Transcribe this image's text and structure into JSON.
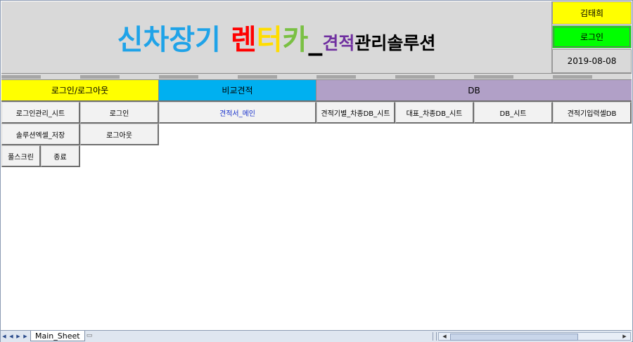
{
  "header": {
    "title_parts": [
      {
        "text": "신",
        "color": "#1fa3e8"
      },
      {
        "text": "차",
        "color": "#1fa3e8"
      },
      {
        "text": "장",
        "color": "#1fa3e8"
      },
      {
        "text": "기",
        "color": "#1fa3e8"
      },
      {
        "text": "렌",
        "color": "#ff0000"
      },
      {
        "text": "터",
        "color": "#ffdd00"
      },
      {
        "text": "카",
        "color": "#7ac043"
      },
      {
        "text": "_",
        "color": "#000000"
      },
      {
        "text": "견적",
        "color": "#7030a0"
      },
      {
        "text": "관리솔루션",
        "color": "#000000"
      }
    ],
    "user_name": "김태희",
    "login_button": "로그인",
    "date": "2019-08-08"
  },
  "sections": {
    "login": "로그인/로그아웃",
    "compare": "비교견적",
    "db": "DB"
  },
  "buttons": {
    "login_admin_sheet": "로그인관리_시트",
    "login": "로그인",
    "solution_excel_save": "솔루션엑셀_저장",
    "logout": "로그아웃",
    "fullscreen": "풀스크린",
    "exit": "종료",
    "estimate_main": "견적서_메인",
    "estimate_model_db_sheet": "견적기별_차종DB_시트",
    "representative_model_db_sheet": "대표_차종DB_시트",
    "db_sheet": "DB_시트",
    "estimate_input_cell_db": "견적기입력셀DB"
  },
  "sheet_tabs": [
    "Main_Sheet"
  ],
  "colors": {
    "header_bg": "#d9d9d9",
    "login_section": "#ffff00",
    "compare_section": "#00b0f0",
    "db_section": "#b1a0c7",
    "login_button_bg": "#00ff00"
  }
}
